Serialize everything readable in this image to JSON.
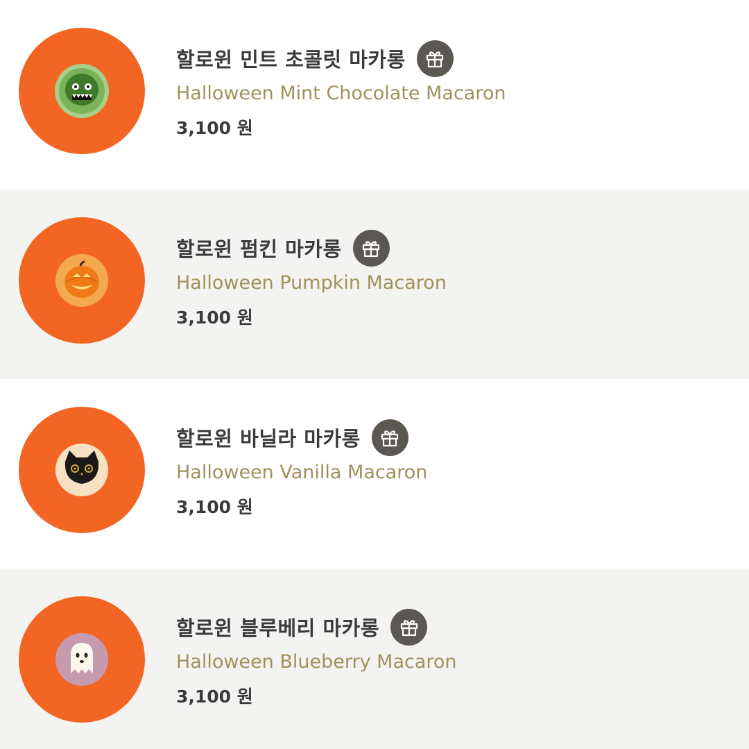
{
  "colors": {
    "thumb_background": "#f26522",
    "alt_row_background": "#f3f3f1",
    "english_name": "#a0915b",
    "gift_button": "#5b5753"
  },
  "products": [
    {
      "name_ko": "할로윈 민트 초콜릿 마카롱",
      "name_en": "Halloween Mint Chocolate Macaron",
      "price": "3,100 원",
      "image_icon": "mint-chocolate-macaron-zombie-icon",
      "gift_icon": "gift-icon"
    },
    {
      "name_ko": "할로윈 펌킨 마카롱",
      "name_en": "Halloween Pumpkin Macaron",
      "price": "3,100 원",
      "image_icon": "pumpkin-macaron-jack-o-lantern-icon",
      "gift_icon": "gift-icon"
    },
    {
      "name_ko": "할로윈 바닐라 마카롱",
      "name_en": "Halloween Vanilla Macaron",
      "price": "3,100 원",
      "image_icon": "vanilla-macaron-black-cat-icon",
      "gift_icon": "gift-icon"
    },
    {
      "name_ko": "할로윈 블루베리 마카롱",
      "name_en": "Halloween Blueberry Macaron",
      "price": "3,100 원",
      "image_icon": "blueberry-macaron-ghost-icon",
      "gift_icon": "gift-icon"
    }
  ]
}
